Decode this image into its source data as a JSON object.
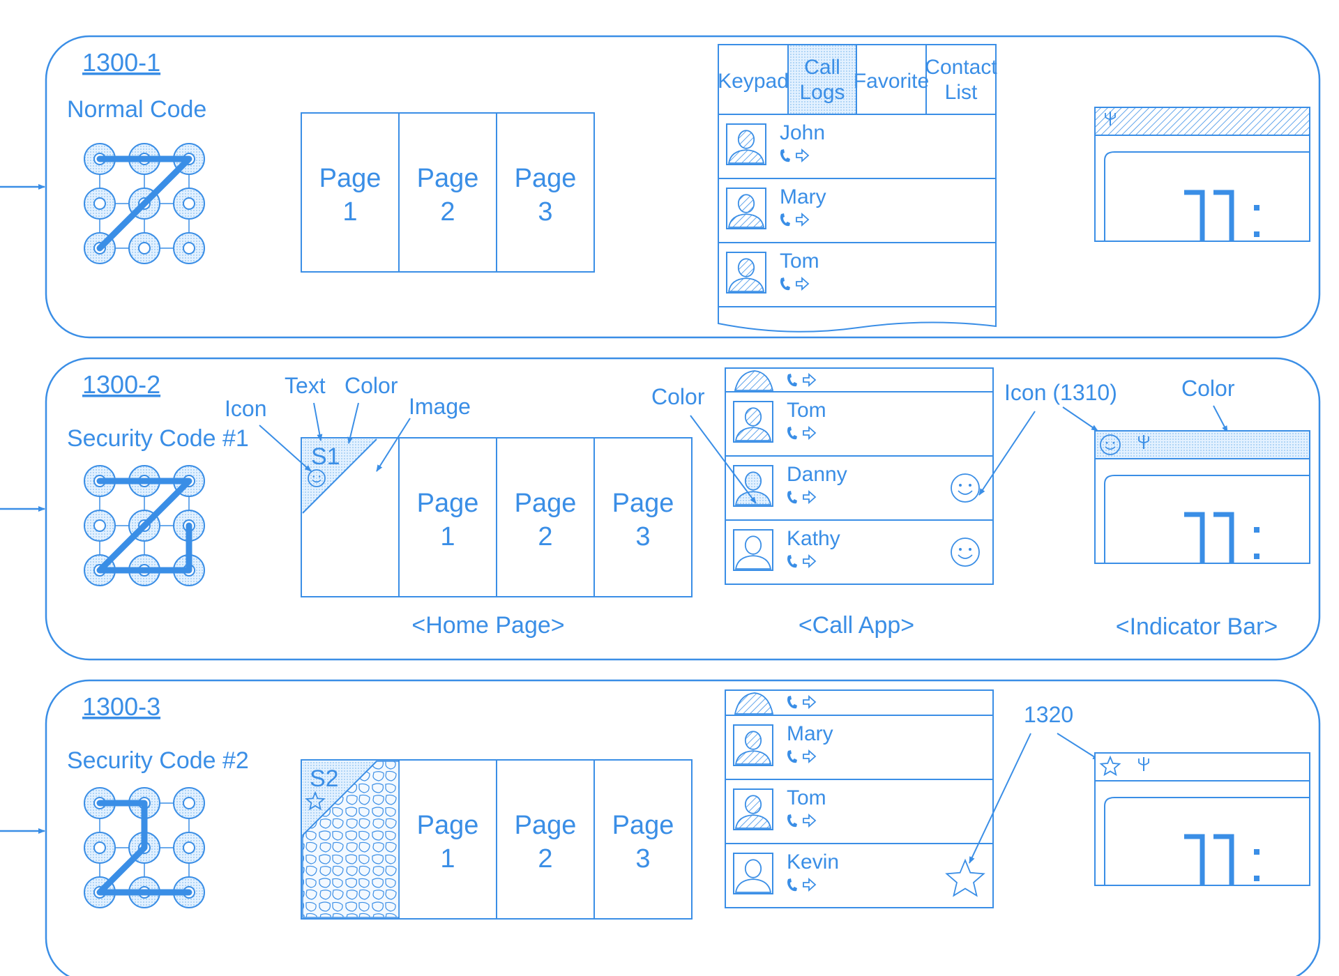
{
  "colors": {
    "ink": "#3a8ee6",
    "fill_light": "#cfe6fb",
    "fill_dot": "#dcefff"
  },
  "panels": [
    {
      "ref": "1300-1",
      "code_label": "Normal Code",
      "pattern": [
        0,
        1,
        2,
        4,
        6
      ],
      "home_pages": [
        {
          "word": "Page",
          "num": "1"
        },
        {
          "word": "Page",
          "num": "2"
        },
        {
          "word": "Page",
          "num": "3"
        }
      ],
      "call_tabs": [
        {
          "lines": [
            "Keypad"
          ]
        },
        {
          "lines": [
            "Call",
            "Logs"
          ],
          "selected": true
        },
        {
          "lines": [
            "Favorite"
          ]
        },
        {
          "lines": [
            "Contact",
            "List"
          ]
        }
      ],
      "contacts": [
        {
          "name": "John"
        },
        {
          "name": "Mary"
        },
        {
          "name": "Tom"
        }
      ],
      "indicator_icon": "signal-antenna-icon",
      "clock_text": "11:"
    },
    {
      "ref": "1300-2",
      "code_label": "Security Code #1",
      "pattern": [
        0,
        1,
        2,
        4,
        6,
        7,
        8,
        5
      ],
      "space_label": "S1",
      "space_icon": "smiley-icon",
      "annotations_home": {
        "icon": "Icon",
        "text": "Text",
        "color": "Color",
        "image": "Image"
      },
      "home_pages": [
        {
          "word": "Page",
          "num": "1"
        },
        {
          "word": "Page",
          "num": "2"
        },
        {
          "word": "Page",
          "num": "3"
        }
      ],
      "contacts": [
        {
          "name": ""
        },
        {
          "name": "Tom"
        },
        {
          "name": "Danny",
          "mark": "smiley-icon",
          "highlight": true
        },
        {
          "name": "Kathy",
          "mark": "smiley-icon"
        }
      ],
      "annotation_call_color": "Color",
      "annotation_icon_ref": "Icon (1310)",
      "annotation_bar_color": "Color",
      "indicator_icons": [
        "smiley-icon",
        "signal-antenna-icon"
      ],
      "clock_text": "11:",
      "captions": {
        "home": "<Home Page>",
        "call": "<Call App>",
        "indicator": "<Indicator Bar>"
      }
    },
    {
      "ref": "1300-3",
      "code_label": "Security Code #2",
      "pattern": [
        0,
        1,
        4,
        6,
        7,
        8
      ],
      "space_label": "S2",
      "space_icon": "star-icon",
      "home_pages": [
        {
          "word": "Page",
          "num": "1"
        },
        {
          "word": "Page",
          "num": "2"
        },
        {
          "word": "Page",
          "num": "3"
        }
      ],
      "contacts": [
        {
          "name": ""
        },
        {
          "name": "Mary"
        },
        {
          "name": "Tom"
        },
        {
          "name": "Kevin",
          "mark": "star-icon"
        }
      ],
      "annotation_ref": "1320",
      "indicator_icons": [
        "star-icon",
        "signal-antenna-icon"
      ],
      "clock_text": "11:"
    }
  ]
}
